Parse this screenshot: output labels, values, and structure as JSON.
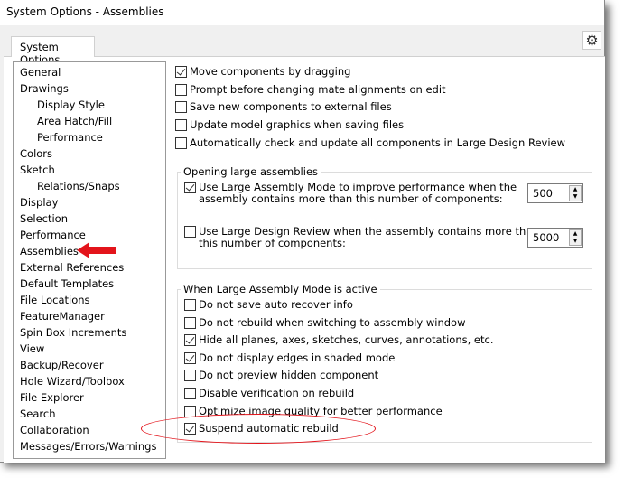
{
  "window": {
    "title": "System Options - Assemblies",
    "tab": "System Options",
    "gear_icon": "gear-icon"
  },
  "sidebar": {
    "items": [
      {
        "label": "General",
        "sub": false
      },
      {
        "label": "Drawings",
        "sub": false
      },
      {
        "label": "Display Style",
        "sub": true
      },
      {
        "label": "Area Hatch/Fill",
        "sub": true
      },
      {
        "label": "Performance",
        "sub": true
      },
      {
        "label": "Colors",
        "sub": false
      },
      {
        "label": "Sketch",
        "sub": false
      },
      {
        "label": "Relations/Snaps",
        "sub": true
      },
      {
        "label": "Display",
        "sub": false
      },
      {
        "label": "Selection",
        "sub": false
      },
      {
        "label": "Performance",
        "sub": false
      },
      {
        "label": "Assemblies",
        "sub": false,
        "selected": true
      },
      {
        "label": "External References",
        "sub": false
      },
      {
        "label": "Default Templates",
        "sub": false
      },
      {
        "label": "File Locations",
        "sub": false
      },
      {
        "label": "FeatureManager",
        "sub": false
      },
      {
        "label": "Spin Box Increments",
        "sub": false
      },
      {
        "label": "View",
        "sub": false
      },
      {
        "label": "Backup/Recover",
        "sub": false
      },
      {
        "label": "Hole Wizard/Toolbox",
        "sub": false
      },
      {
        "label": "File Explorer",
        "sub": false
      },
      {
        "label": "Search",
        "sub": false
      },
      {
        "label": "Collaboration",
        "sub": false
      },
      {
        "label": "Messages/Errors/Warnings",
        "sub": false
      }
    ]
  },
  "options": [
    {
      "label": "Move components by dragging",
      "checked": true
    },
    {
      "label": "Prompt before changing mate alignments on edit",
      "checked": false
    },
    {
      "label": "Save new components to external files",
      "checked": false
    },
    {
      "label": "Update model graphics when saving files",
      "checked": false
    },
    {
      "label": "Automatically check and update all components in Large Design Review",
      "checked": false
    }
  ],
  "opening_group": {
    "title": "Opening large assemblies",
    "lam": {
      "line1": "Use Large Assembly Mode to improve performance when the",
      "line2": "assembly contains more than this number of components:",
      "checked": true,
      "value": "500"
    },
    "ldr": {
      "line1": "Use Large Design Review when the assembly contains more than",
      "line2": "this number of components:",
      "checked": false,
      "value": "5000"
    }
  },
  "lam_group": {
    "title": "When Large Assembly Mode is active",
    "items": [
      {
        "label": "Do not save auto recover info",
        "checked": false
      },
      {
        "label": "Do not rebuild when switching to assembly window",
        "checked": false
      },
      {
        "label": "Hide all planes, axes, sketches, curves, annotations, etc.",
        "checked": true
      },
      {
        "label": "Do not display edges in shaded mode",
        "checked": true
      },
      {
        "label": "Do not preview hidden component",
        "checked": false
      },
      {
        "label": "Disable verification on rebuild",
        "checked": false
      },
      {
        "label": "Optimize image quality for better performance",
        "checked": false
      },
      {
        "label": "Suspend automatic rebuild",
        "checked": true,
        "highlighted": true
      }
    ]
  },
  "annotation_color": "#e3141b"
}
